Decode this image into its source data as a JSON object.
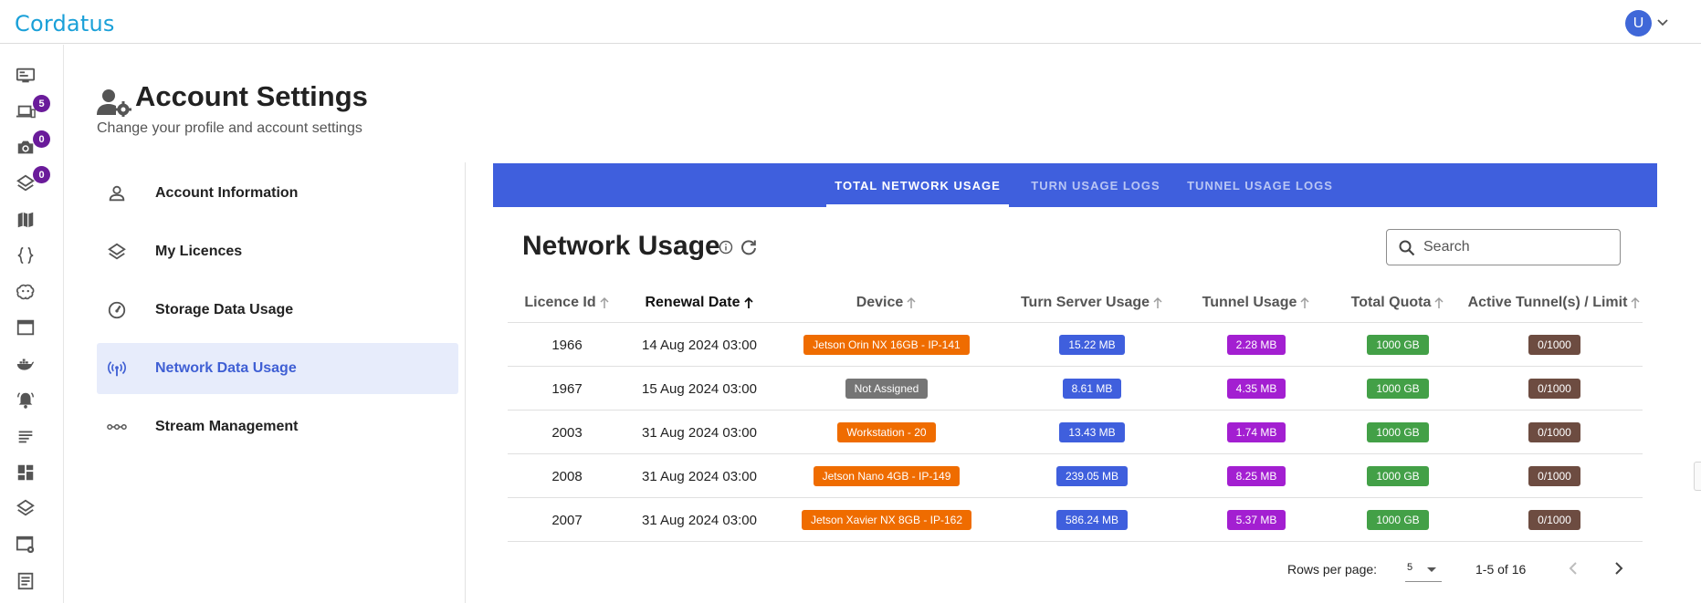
{
  "app": {
    "logo": "Cordatus",
    "user_initial": "U"
  },
  "rail": {
    "items": [
      {
        "icon": "monitor-dashboard-icon"
      },
      {
        "icon": "devices-icon",
        "badge": "5"
      },
      {
        "icon": "camera-icon",
        "badge": "0"
      },
      {
        "icon": "layers-icon",
        "badge": "0"
      },
      {
        "icon": "map-icon"
      },
      {
        "icon": "code-braces-icon"
      },
      {
        "icon": "brain-icon"
      },
      {
        "icon": "browser-window-icon"
      },
      {
        "icon": "docker-icon"
      },
      {
        "icon": "bell-alert-icon"
      },
      {
        "icon": "text-lines-icon"
      },
      {
        "icon": "dashboard-tiles-icon"
      },
      {
        "icon": "layers-outline-icon"
      },
      {
        "icon": "window-cog-icon"
      },
      {
        "icon": "document-list-icon"
      }
    ]
  },
  "page": {
    "title": "Account Settings",
    "subtitle": "Change your profile and account settings"
  },
  "settings_nav": {
    "items": [
      {
        "label": "Account Information",
        "icon": "person-icon",
        "active": false
      },
      {
        "label": "My Licences",
        "icon": "layers-icon",
        "active": false
      },
      {
        "label": "Storage Data Usage",
        "icon": "speedometer-icon",
        "active": false
      },
      {
        "label": "Network Data Usage",
        "icon": "broadcast-antenna-icon",
        "active": true
      },
      {
        "label": "Stream Management",
        "icon": "stream-nodes-icon",
        "active": false
      }
    ]
  },
  "tabs": [
    {
      "label": "TOTAL NETWORK USAGE",
      "active": true
    },
    {
      "label": "TURN USAGE LOGS",
      "active": false
    },
    {
      "label": "TUNNEL USAGE LOGS",
      "active": false
    }
  ],
  "card": {
    "title": "Network Usage",
    "search_placeholder": "Search"
  },
  "table": {
    "columns": [
      "Licence Id",
      "Renewal Date",
      "Device",
      "Turn Server Usage",
      "Tunnel Usage",
      "Total Quota",
      "Active Tunnel(s) / Limit"
    ],
    "sorted_column": "Renewal Date",
    "rows": [
      {
        "licence_id": "1966",
        "renewal_date": "14 Aug 2024 03:00",
        "device": "Jetson Orin NX 16GB - IP-141",
        "device_assigned": true,
        "turn_usage": "15.22 MB",
        "tunnel_usage": "2.28 MB",
        "total_quota": "1000 GB",
        "active_tunnels": "0/1000"
      },
      {
        "licence_id": "1967",
        "renewal_date": "15 Aug 2024 03:00",
        "device": "Not Assigned",
        "device_assigned": false,
        "turn_usage": "8.61 MB",
        "tunnel_usage": "4.35 MB",
        "total_quota": "1000 GB",
        "active_tunnels": "0/1000"
      },
      {
        "licence_id": "2003",
        "renewal_date": "31 Aug 2024 03:00",
        "device": "Workstation - 20",
        "device_assigned": true,
        "turn_usage": "13.43 MB",
        "tunnel_usage": "1.74 MB",
        "total_quota": "1000 GB",
        "active_tunnels": "0/1000"
      },
      {
        "licence_id": "2008",
        "renewal_date": "31 Aug 2024 03:00",
        "device": "Jetson Nano 4GB - IP-149",
        "device_assigned": true,
        "turn_usage": "239.05 MB",
        "tunnel_usage": "8.25 MB",
        "total_quota": "1000 GB",
        "active_tunnels": "0/1000"
      },
      {
        "licence_id": "2007",
        "renewal_date": "31 Aug 2024 03:00",
        "device": "Jetson Xavier NX 8GB - IP-162",
        "device_assigned": true,
        "turn_usage": "586.24 MB",
        "tunnel_usage": "5.37 MB",
        "total_quota": "1000 GB",
        "active_tunnels": "0/1000"
      }
    ]
  },
  "pagination": {
    "rows_per_page_label": "Rows per page:",
    "rows_per_page_value": "5",
    "range_text": "1-5 of 16"
  },
  "colors": {
    "brand": "#1aa0d8",
    "tab_band": "#3f5fdd",
    "badge": "#6a1b9a",
    "device_chip": "#ef6c00",
    "unassigned_chip": "#757575",
    "turn_chip": "#3f5fdd",
    "tunnel_chip": "#a31fd1",
    "quota_chip": "#43a047",
    "tunnel_limit_chip": "#6d4c41"
  }
}
